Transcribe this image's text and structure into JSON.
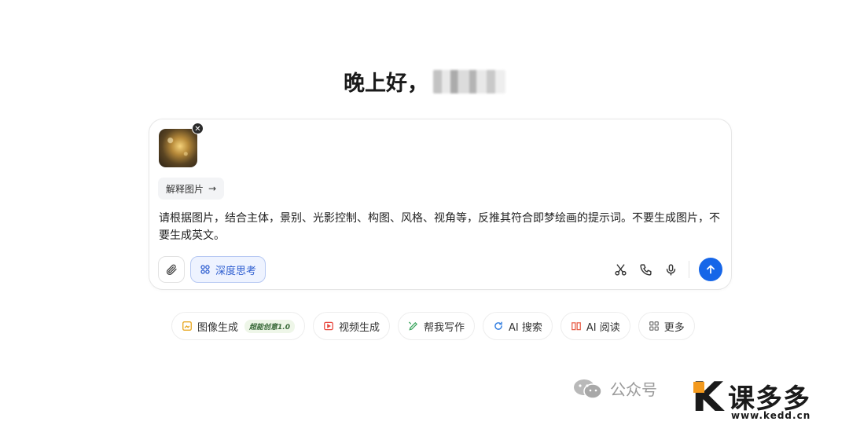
{
  "greeting": {
    "text": "晚上好，"
  },
  "composer": {
    "explain_chip": {
      "label": "解释图片",
      "arrow": "→"
    },
    "prompt": "请根据图片，结合主体，景别、光影控制、构图、风格、视角等，反推其符合即梦绘画的提示词。不要生成图片，不要生成英文。",
    "deep_think_label": "深度思考"
  },
  "chips": [
    {
      "label": "图像生成",
      "badge": "超能创意1.0",
      "icon": "image-gen-icon",
      "color": "#e7a418"
    },
    {
      "label": "视频生成",
      "icon": "video-gen-icon",
      "color": "#e8493f"
    },
    {
      "label": "帮我写作",
      "icon": "pen-icon",
      "color": "#3aa55d"
    },
    {
      "label": "AI 搜索",
      "icon": "search-refresh-icon",
      "color": "#2d7be0"
    },
    {
      "label": "AI 阅读",
      "icon": "book-icon",
      "color": "#e8604a"
    },
    {
      "label": "更多",
      "icon": "grid-icon",
      "color": "#777777"
    }
  ],
  "watermark": {
    "text": "公众号",
    "site_cn": "课多多",
    "site_url": "www.kedd.cn"
  },
  "colors": {
    "accent": "#1666e8",
    "deep_bg": "#eef3ff",
    "deep_border": "#b7c9f3"
  }
}
